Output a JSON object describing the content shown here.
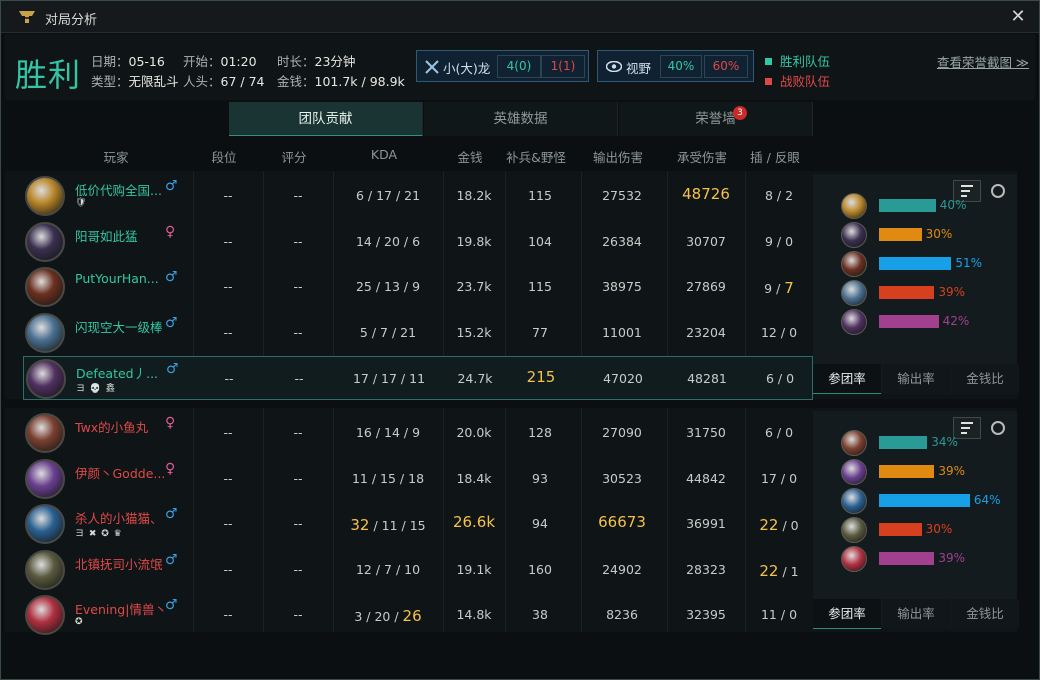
{
  "window": {
    "title": "对局分析",
    "close": "✕"
  },
  "summary": {
    "result": "胜利",
    "date_label": "日期：",
    "date": "05-16",
    "type_label": "类型：",
    "type": "无限乱斗",
    "start_label": "开始：",
    "start": "01:20",
    "kills_label": "人头：",
    "kills": "67 / 74",
    "duration_label": "时长：",
    "duration": "23分钟",
    "gold_label": "金钱：",
    "gold": "101.7k / 98.9k",
    "dragon": {
      "label": "小(大)龙",
      "ally": "4(0)",
      "enemy": "1(1)"
    },
    "vision": {
      "label": "视野",
      "ally": "40%",
      "enemy": "60%"
    },
    "legend_win": "胜利队伍",
    "legend_lose": "战败队伍",
    "honor_link": "查看荣誉截图 ≫"
  },
  "tabs": [
    {
      "label": "团队贡献"
    },
    {
      "label": "英雄数据"
    },
    {
      "label": "荣誉墙",
      "badge": "3"
    }
  ],
  "headers": {
    "player": "玩家",
    "rank": "段位",
    "score": "评分",
    "kda": "KDA",
    "gold": "金钱",
    "cs": "补兵&野怪",
    "dmg": "输出伤害",
    "taken": "承受伤害",
    "wards": "插 / 反眼"
  },
  "colors": {
    "win": "#34c6a4",
    "lose": "#e04848",
    "highlight": "#f6c14a",
    "male": "#3a9de0",
    "female": "#e05a9a"
  },
  "teams": [
    {
      "players": [
        {
          "name": "低价代购全国...",
          "gender": "♂",
          "tags": "🛡",
          "rank": "--",
          "score": "--",
          "k": "6",
          "d": "17",
          "a": "21",
          "gold": "18.2k",
          "cs": "115",
          "dmg": "27532",
          "taken": "48726",
          "wp": "8",
          "wd": "2",
          "hl": "taken",
          "av": "#b8862a"
        },
        {
          "name": "阳哥如此猛",
          "gender": "♀",
          "tags": "",
          "rank": "--",
          "score": "--",
          "k": "14",
          "d": "20",
          "a": "6",
          "gold": "19.8k",
          "cs": "104",
          "dmg": "26384",
          "taken": "30707",
          "wp": "9",
          "wd": "0",
          "hl": "",
          "av": "#3a3050"
        },
        {
          "name": "PutYourHan...",
          "gender": "♂",
          "tags": "",
          "rank": "--",
          "score": "--",
          "k": "25",
          "d": "13",
          "a": "9",
          "gold": "23.7k",
          "cs": "115",
          "dmg": "38975",
          "taken": "27869",
          "wp": "9",
          "wd": "7",
          "hl": "wd",
          "av": "#6a3020"
        },
        {
          "name": "闪现空大一级棒",
          "gender": "♂",
          "tags": "",
          "rank": "--",
          "score": "--",
          "k": "5",
          "d": "7",
          "a": "21",
          "gold": "15.2k",
          "cs": "77",
          "dmg": "11001",
          "taken": "23204",
          "wp": "12",
          "wd": "0",
          "hl": "",
          "av": "#4a7090"
        },
        {
          "name": "Defeated丿...",
          "gender": "♂",
          "tags": "ヨ 💀 鑫",
          "rank": "--",
          "score": "--",
          "k": "17",
          "d": "17",
          "a": "11",
          "gold": "24.7k",
          "cs": "215",
          "dmg": "47020",
          "taken": "48281",
          "wp": "6",
          "wd": "0",
          "hl": "cs",
          "av": "#503060",
          "me": true
        }
      ],
      "side": {
        "pcts": [
          "40%",
          "30%",
          "51%",
          "39%",
          "42%"
        ],
        "vals": [
          40,
          30,
          51,
          39,
          42
        ],
        "tabs": [
          "参团率",
          "输出率",
          "金钱比"
        ]
      }
    },
    {
      "players": [
        {
          "name": "Twx的小鱼丸",
          "gender": "♀",
          "tags": "",
          "rank": "--",
          "score": "--",
          "k": "16",
          "d": "14",
          "a": "9",
          "gold": "20.0k",
          "cs": "128",
          "dmg": "27090",
          "taken": "31750",
          "wp": "6",
          "wd": "0",
          "hl": "",
          "av": "#7a4030"
        },
        {
          "name": "伊颜丶Godde...",
          "gender": "♀",
          "tags": "",
          "rank": "--",
          "score": "--",
          "k": "11",
          "d": "15",
          "a": "18",
          "gold": "18.4k",
          "cs": "93",
          "dmg": "30523",
          "taken": "44842",
          "wp": "17",
          "wd": "0",
          "hl": "",
          "av": "#6a4090"
        },
        {
          "name": "杀人的小猫猫、",
          "gender": "♂",
          "tags": "ヨ ✖ ✪ ♛",
          "rank": "--",
          "score": "--",
          "k": "32",
          "d": "11",
          "a": "15",
          "gold": "26.6k",
          "cs": "94",
          "dmg": "66673",
          "taken": "36991",
          "wp": "22",
          "wd": "0",
          "hl": "kgdw",
          "av": "#2a6090"
        },
        {
          "name": "北镇抚司小流氓",
          "gender": "♂",
          "tags": "",
          "rank": "--",
          "score": "--",
          "k": "12",
          "d": "7",
          "a": "10",
          "gold": "19.1k",
          "cs": "160",
          "dmg": "24902",
          "taken": "28323",
          "wp": "22",
          "wd": "1",
          "hl": "wp",
          "av": "#5a5a40"
        },
        {
          "name": "Evening|情兽丶",
          "gender": "♂",
          "tags": "✪",
          "rank": "--",
          "score": "--",
          "k": "3",
          "d": "20",
          "a": "26",
          "gold": "14.8k",
          "cs": "38",
          "dmg": "8236",
          "taken": "32395",
          "wp": "11",
          "wd": "0",
          "hl": "a",
          "av": "#b03040"
        }
      ],
      "side": {
        "pcts": [
          "34%",
          "39%",
          "64%",
          "30%",
          "39%"
        ],
        "vals": [
          34,
          39,
          64,
          30,
          39
        ],
        "tabs": [
          "参团率",
          "输出率",
          "金钱比"
        ]
      }
    }
  ]
}
